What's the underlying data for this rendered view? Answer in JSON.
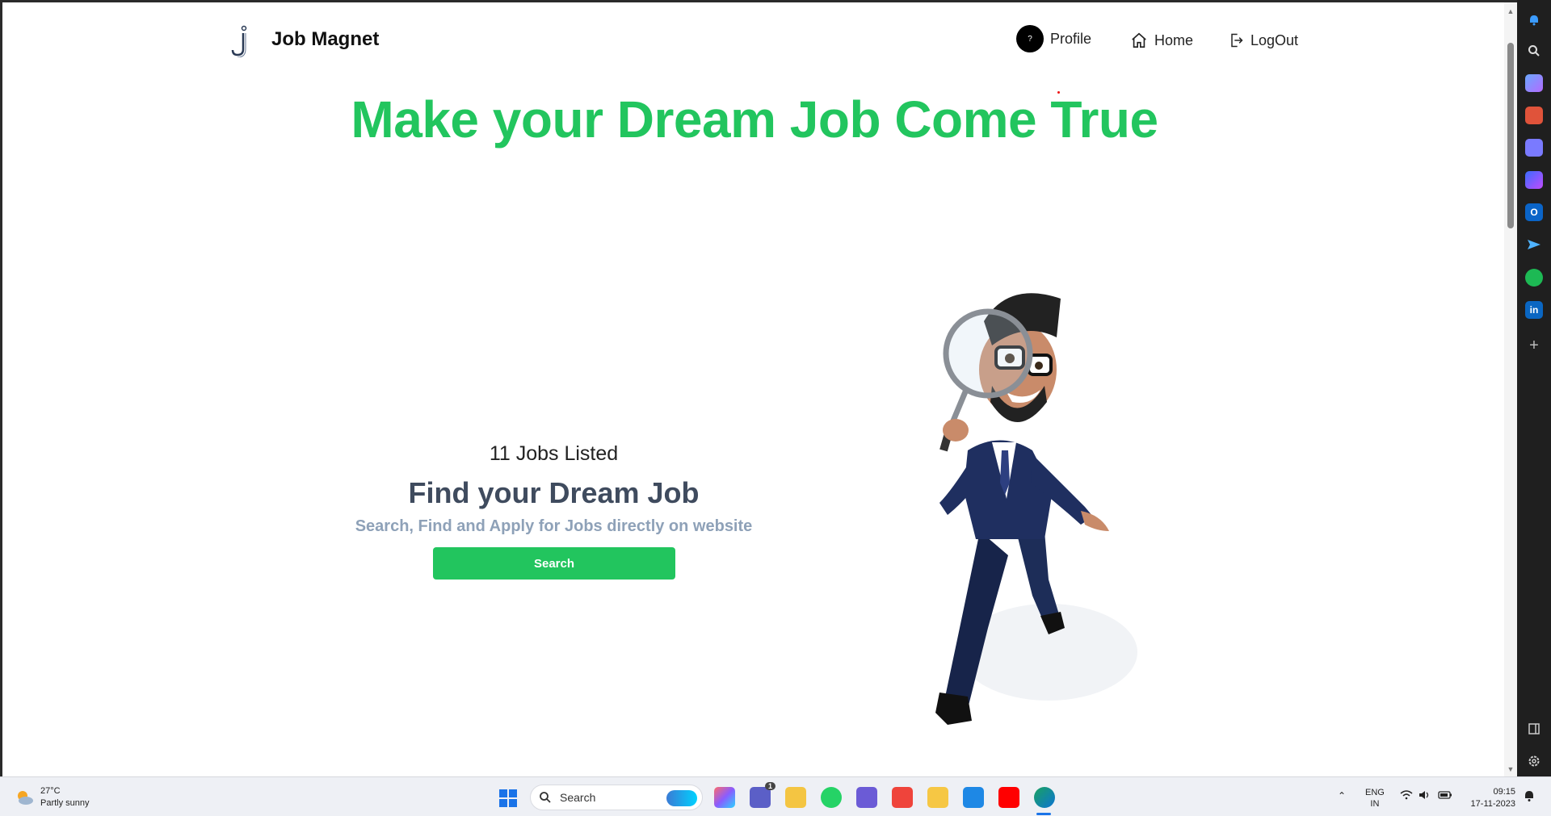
{
  "navbar": {
    "brand": "Job Magnet",
    "logo_letter": "j",
    "avatar_text": "?",
    "profile_label": "Profile",
    "home_label": "Home",
    "logout_label": "LogOut"
  },
  "hero": {
    "title": "Make your Dream Job Come True",
    "title_color": "#22c55e"
  },
  "jobs": {
    "count_text": "11 Jobs Listed",
    "heading": "Find your Dream Job",
    "subtitle": "Search, Find and Apply for Jobs directly on website",
    "search_button": "Search",
    "button_color": "#22c55e"
  },
  "edge_sidebar": {
    "icons": [
      "bell-icon",
      "search-icon",
      "tag-icon",
      "toolbox-icon",
      "chess-icon",
      "copilot-icon",
      "outlook-icon",
      "send-icon",
      "spotify-icon",
      "linkedin-icon",
      "add-icon",
      "panel-icon",
      "settings-icon"
    ],
    "linkedin_text": "in",
    "outlook_text": "O",
    "add_text": "+"
  },
  "taskbar": {
    "weather_temp": "27°C",
    "weather_desc": "Partly sunny",
    "search_placeholder": "Search",
    "teams_badge": "1",
    "language_top": "ENG",
    "language_bottom": "IN",
    "time": "09:15",
    "date": "17-11-2023",
    "apps": [
      "windows-start-icon",
      "copilot-app-icon",
      "teams-icon",
      "file-explorer-icon",
      "whatsapp-icon",
      "app-icon",
      "anydesk-icon",
      "folder-icon",
      "vscode-icon",
      "youtube-icon",
      "edge-icon"
    ]
  }
}
